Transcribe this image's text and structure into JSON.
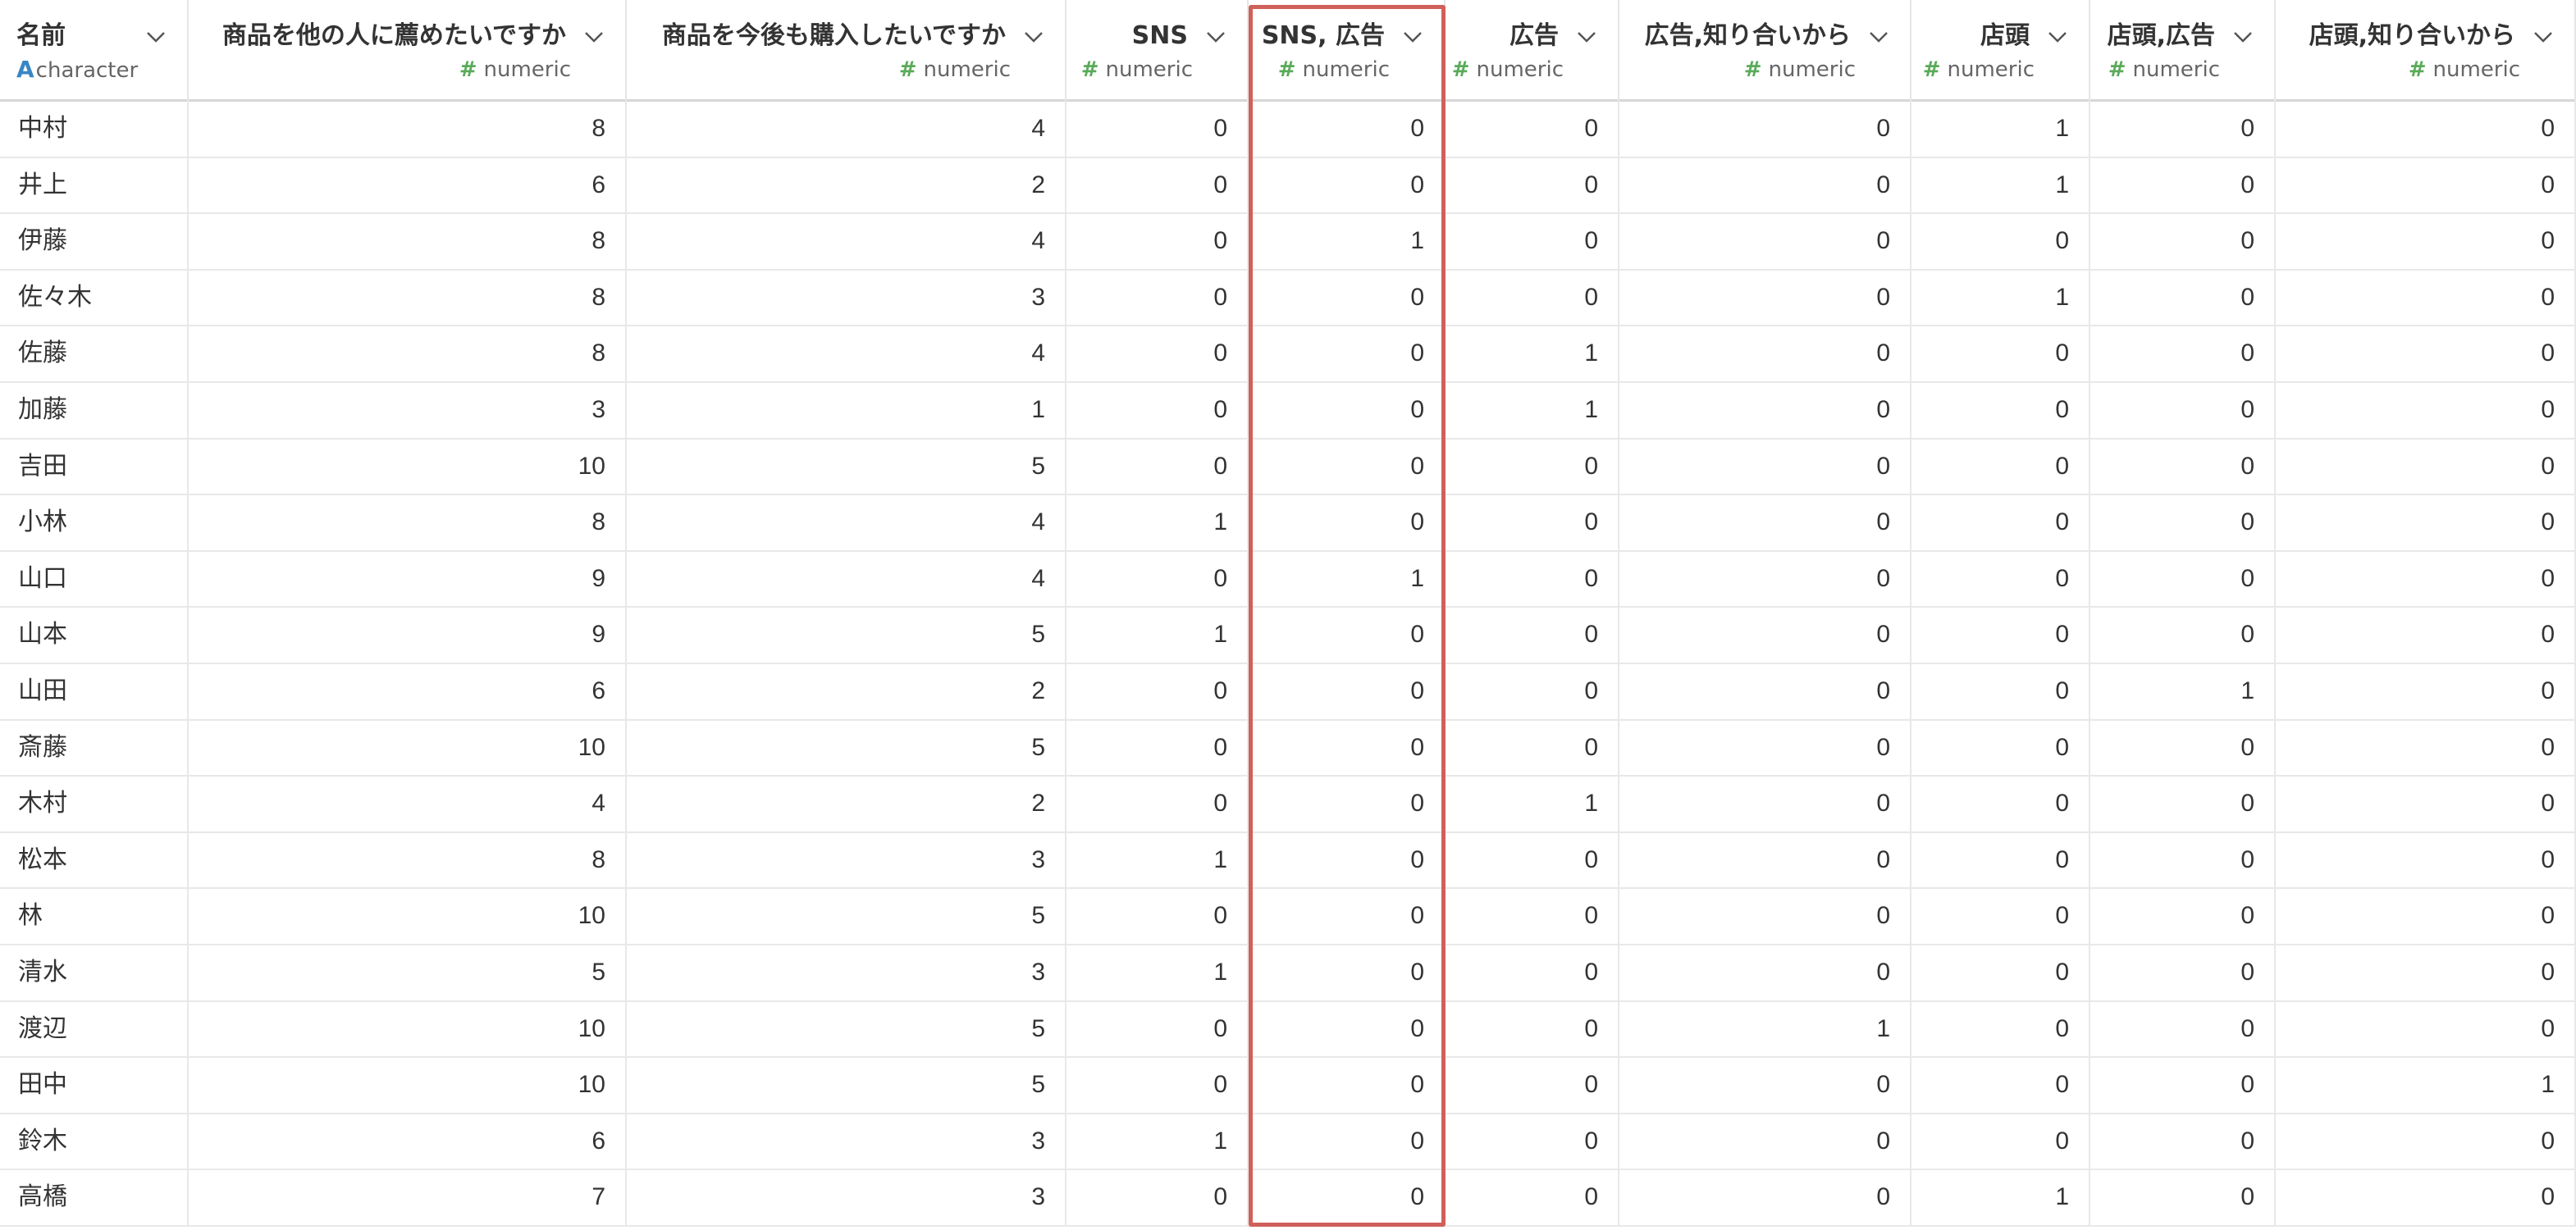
{
  "columns": [
    {
      "name": "名前",
      "type": "character"
    },
    {
      "name": "商品を他の人に薦めたいですか",
      "type": "numeric"
    },
    {
      "name": "商品を今後も購入したいですか",
      "type": "numeric"
    },
    {
      "name": "SNS",
      "type": "numeric"
    },
    {
      "name": "SNS, 広告",
      "type": "numeric"
    },
    {
      "name": "広告",
      "type": "numeric"
    },
    {
      "name": "広告,知り合いから",
      "type": "numeric"
    },
    {
      "name": "店頭",
      "type": "numeric"
    },
    {
      "name": "店頭,広告",
      "type": "numeric"
    },
    {
      "name": "店頭,知り合いから",
      "type": "numeric"
    }
  ],
  "highlighted_column": "SNS, 広告",
  "highlight_color": "#d0605a",
  "rows": [
    [
      "中村",
      "8",
      "4",
      "0",
      "0",
      "0",
      "0",
      "1",
      "0",
      "0"
    ],
    [
      "井上",
      "6",
      "2",
      "0",
      "0",
      "0",
      "0",
      "1",
      "0",
      "0"
    ],
    [
      "伊藤",
      "8",
      "4",
      "0",
      "1",
      "0",
      "0",
      "0",
      "0",
      "0"
    ],
    [
      "佐々木",
      "8",
      "3",
      "0",
      "0",
      "0",
      "0",
      "1",
      "0",
      "0"
    ],
    [
      "佐藤",
      "8",
      "4",
      "0",
      "0",
      "1",
      "0",
      "0",
      "0",
      "0"
    ],
    [
      "加藤",
      "3",
      "1",
      "0",
      "0",
      "1",
      "0",
      "0",
      "0",
      "0"
    ],
    [
      "吉田",
      "10",
      "5",
      "0",
      "0",
      "0",
      "0",
      "0",
      "0",
      "0"
    ],
    [
      "小林",
      "8",
      "4",
      "1",
      "0",
      "0",
      "0",
      "0",
      "0",
      "0"
    ],
    [
      "山口",
      "9",
      "4",
      "0",
      "1",
      "0",
      "0",
      "0",
      "0",
      "0"
    ],
    [
      "山本",
      "9",
      "5",
      "1",
      "0",
      "0",
      "0",
      "0",
      "0",
      "0"
    ],
    [
      "山田",
      "6",
      "2",
      "0",
      "0",
      "0",
      "0",
      "0",
      "1",
      "0"
    ],
    [
      "斎藤",
      "10",
      "5",
      "0",
      "0",
      "0",
      "0",
      "0",
      "0",
      "0"
    ],
    [
      "木村",
      "4",
      "2",
      "0",
      "0",
      "1",
      "0",
      "0",
      "0",
      "0"
    ],
    [
      "松本",
      "8",
      "3",
      "1",
      "0",
      "0",
      "0",
      "0",
      "0",
      "0"
    ],
    [
      "林",
      "10",
      "5",
      "0",
      "0",
      "0",
      "0",
      "0",
      "0",
      "0"
    ],
    [
      "清水",
      "5",
      "3",
      "1",
      "0",
      "0",
      "0",
      "0",
      "0",
      "0"
    ],
    [
      "渡辺",
      "10",
      "5",
      "0",
      "0",
      "0",
      "1",
      "0",
      "0",
      "0"
    ],
    [
      "田中",
      "10",
      "5",
      "0",
      "0",
      "0",
      "0",
      "0",
      "0",
      "1"
    ],
    [
      "鈴木",
      "6",
      "3",
      "1",
      "0",
      "0",
      "0",
      "0",
      "0",
      "0"
    ],
    [
      "高橋",
      "7",
      "3",
      "0",
      "0",
      "0",
      "0",
      "1",
      "0",
      "0"
    ]
  ]
}
